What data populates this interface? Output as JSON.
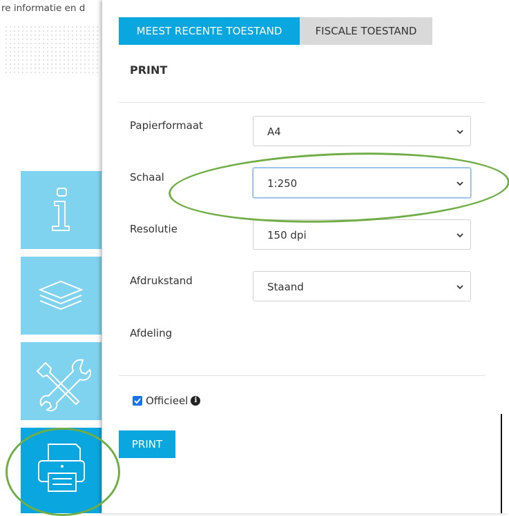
{
  "background": {
    "text": "re informatie en d"
  },
  "tabs": [
    {
      "label": "MEEST RECENTE TOESTAND",
      "active": true
    },
    {
      "label": "FISCALE TOESTAND",
      "active": false
    }
  ],
  "panel": {
    "title": "PRINT",
    "fields": [
      {
        "label": "Papierformaat",
        "value": "A4"
      },
      {
        "label": "Schaal",
        "value": "1:250"
      },
      {
        "label": "Resolutie",
        "value": "150 dpi"
      },
      {
        "label": "Afdrukstand",
        "value": "Staand"
      }
    ],
    "afdeling_label": "Afdeling",
    "checkbox_label": "Officieel",
    "checkbox_checked": true,
    "print_button": "PRINT"
  },
  "toolbar": {
    "icons": [
      "info-icon",
      "layers-icon",
      "tools-icon",
      "printer-icon"
    ]
  },
  "colors": {
    "accent": "#0aa6df",
    "toolbar": "#7fd3ee",
    "annotation": "#71ad47"
  }
}
